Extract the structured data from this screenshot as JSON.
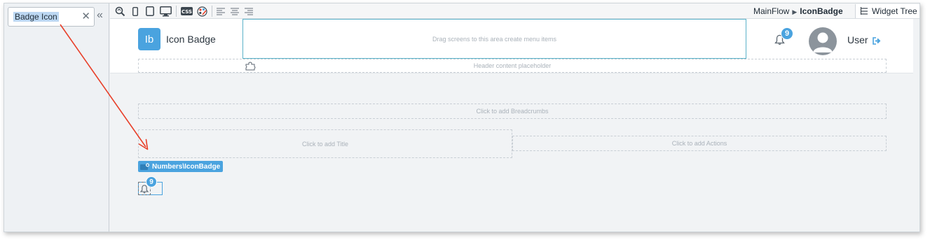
{
  "search": {
    "value": "Badge Icon"
  },
  "toolbar": {
    "breadcrumb": {
      "flow": "MainFlow",
      "screen": "IconBadge"
    },
    "widget_tree_label": "Widget Tree",
    "icons": [
      "preview-icon",
      "phone-icon",
      "tablet-icon",
      "desktop-icon",
      "css-icon",
      "theme-palette-icon",
      "align-left-icon",
      "align-center-icon",
      "align-right-icon"
    ]
  },
  "header": {
    "logo_initials": "Ib",
    "app_name": "Icon Badge",
    "menu_dropzone": "Drag screens to this area create menu items",
    "notification_count": "9",
    "user_name": "User",
    "placeholder": "Header content placeholder"
  },
  "content": {
    "breadcrumbs_placeholder": "Click to add Breadcrumbs",
    "title_placeholder": "Click to add Title",
    "actions_placeholder": "Click to add Actions"
  },
  "widget": {
    "label": "Numbers\\IconBadge",
    "badge_count": "9"
  },
  "colors": {
    "accent": "#4aa3df",
    "annotation_arrow": "#e8402a",
    "selection_highlight": "#bcd7f2"
  }
}
